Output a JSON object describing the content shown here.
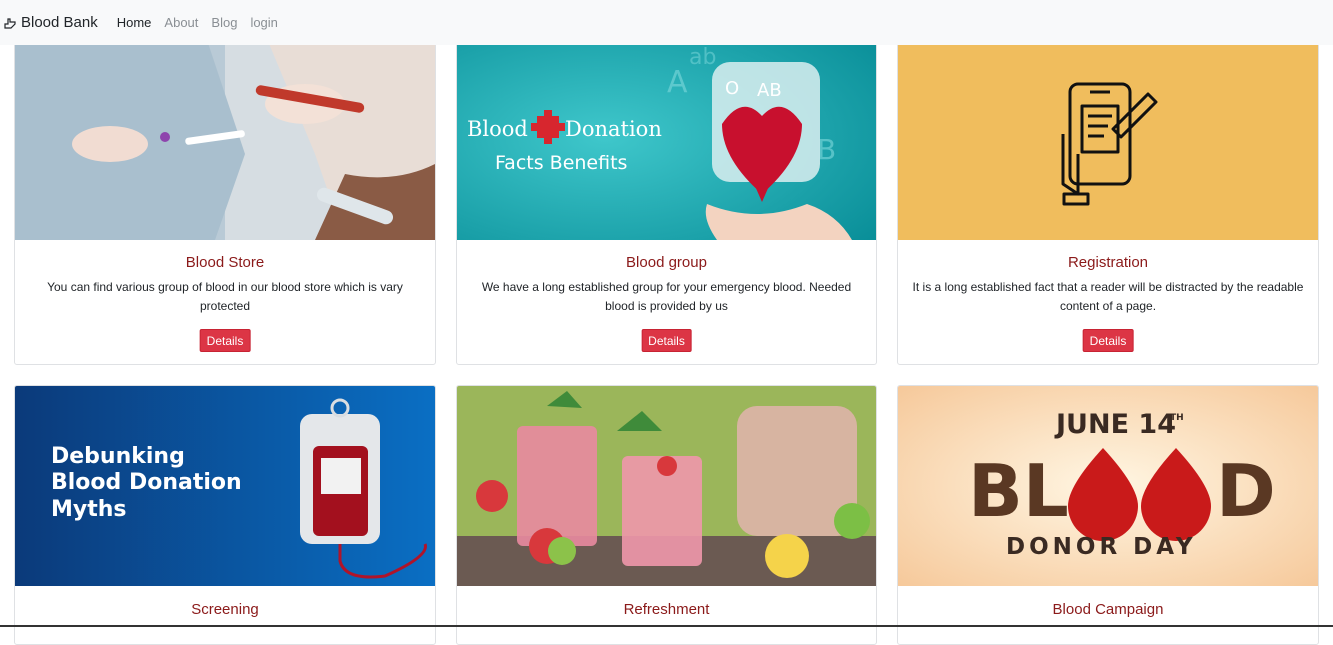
{
  "navbar": {
    "brand": "Blood Bank",
    "links": [
      "Home",
      "About",
      "Blog",
      "login"
    ]
  },
  "cards": [
    {
      "title": "Blood Store",
      "text": "You can find various group of blood in our blood store which is vary protected",
      "button": "Details",
      "image": {
        "kind": "photo-blood-sample",
        "bg": "#c9d3da"
      }
    },
    {
      "title": "Blood group",
      "text": "We have a long established group for your emergency blood. Needed blood is provided by us",
      "button": "Details",
      "image": {
        "kind": "blood-donation-banner",
        "bg": "#1fb3b8",
        "line1a": "Blood",
        "line1b": "Donation",
        "line2": "Facts Benefits",
        "letters": [
          "A",
          "B",
          "ab",
          "O",
          "AB"
        ]
      }
    },
    {
      "title": "Registration",
      "text": "It is a long established fact that a reader will be distracted by the readable content of a page.",
      "button": "Details",
      "image": {
        "kind": "phone-registration-icon",
        "bg": "#f0bd5d"
      }
    },
    {
      "title": "Screening",
      "image": {
        "kind": "myths-banner",
        "bg": "#0d4f9e",
        "lines": [
          "Debunking",
          "Blood Donation",
          "Myths"
        ]
      }
    },
    {
      "title": "Refreshment",
      "image": {
        "kind": "photo-drinks",
        "bg": "#c95a6d"
      }
    },
    {
      "title": "Blood Campaign",
      "image": {
        "kind": "donor-day-banner",
        "bg": "#fbe8cf",
        "date": "JUNE 14",
        "date_sup": "TH",
        "word_left": "BL",
        "word_right": "D",
        "subtitle": "DONOR DAY"
      }
    }
  ],
  "colors": {
    "accent": "#dc3545",
    "title": "#8b1a1a",
    "navbar_bg": "#f8f9fa"
  }
}
